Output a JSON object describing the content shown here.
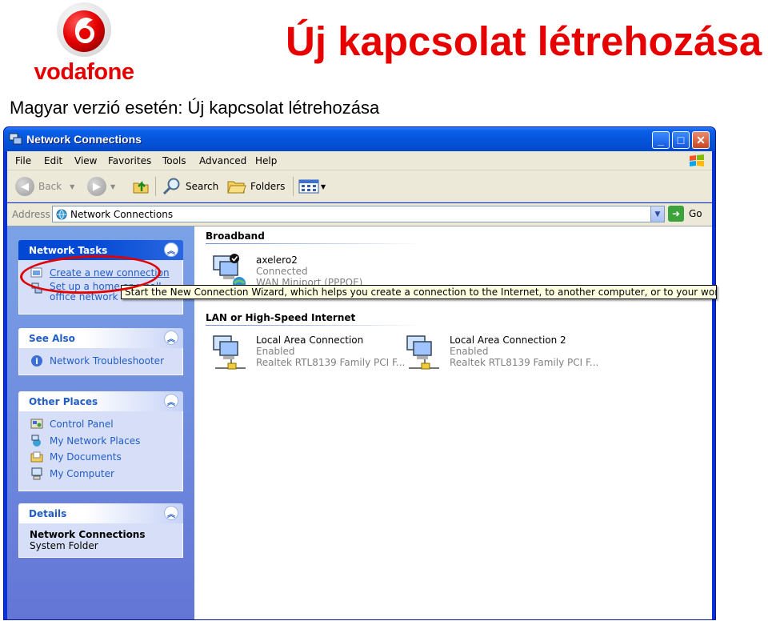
{
  "slide": {
    "brand": "vodafone",
    "title": "Új kapcsolat létrehozása",
    "subtitle": "Magyar verzió esetén: Új kapcsolat létrehozása",
    "brand_color": "#e60000"
  },
  "window": {
    "title": "Network Connections",
    "icon": "network-connections-icon",
    "controls": [
      "minimize",
      "maximize",
      "close"
    ]
  },
  "menu": [
    "File",
    "Edit",
    "View",
    "Favorites",
    "Tools",
    "Advanced",
    "Help"
  ],
  "toolbar": {
    "back": "Back",
    "search": "Search",
    "folders": "Folders"
  },
  "address": {
    "label": "Address",
    "value": "Network Connections",
    "go": "Go"
  },
  "left_pane": {
    "network_tasks": {
      "title": "Network Tasks",
      "items": [
        "Create a new connection",
        "Set up a home or small office network"
      ]
    },
    "see_also": {
      "title": "See Also",
      "items": [
        "Network Troubleshooter"
      ]
    },
    "other_places": {
      "title": "Other Places",
      "items": [
        "Control Panel",
        "My Network Places",
        "My Documents",
        "My Computer"
      ]
    },
    "details": {
      "title": "Details",
      "name": "Network Connections",
      "type": "System Folder"
    }
  },
  "groups": {
    "broadband": {
      "title": "Broadband",
      "items": [
        {
          "name": "axelero2",
          "status": "Connected",
          "device": "WAN Miniport (PPPOE)"
        }
      ]
    },
    "lan": {
      "title": "LAN or High-Speed Internet",
      "items": [
        {
          "name": "Local Area Connection",
          "status": "Enabled",
          "device": "Realtek RTL8139 Family PCI F..."
        },
        {
          "name": "Local Area Connection 2",
          "status": "Enabled",
          "device": "Realtek RTL8139 Family PCI F..."
        }
      ]
    }
  },
  "tooltip": "Start the New Connection Wizard, which helps you create a connection to the Internet, to another computer, or to your workplace network."
}
